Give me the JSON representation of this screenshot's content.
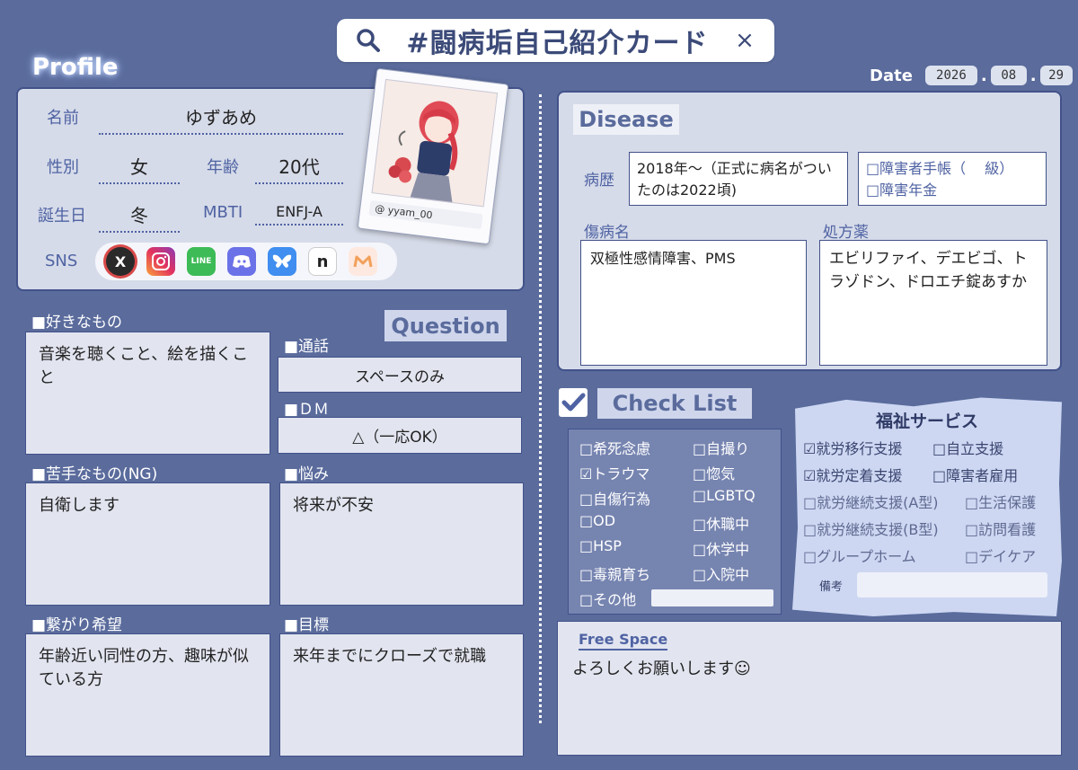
{
  "search": {
    "query": "#闘病垢自己紹介カード",
    "search_icon": "search-icon",
    "close_label": "×"
  },
  "profile": {
    "title": "Profile",
    "name_label": "名前",
    "name_value": "ゆずあめ",
    "gender_label": "性別",
    "gender_value": "女",
    "age_label": "年齢",
    "age_value": "20代",
    "birthday_label": "誕生日",
    "birthday_value": "冬",
    "mbti_label": "MBTI",
    "mbti_value": "ENFJ-A",
    "sns_label": "SNS",
    "photo_handle": "@ yyam_00",
    "sns_icons": [
      "x-icon",
      "instagram-icon",
      "line-icon",
      "discord-icon",
      "bluesky-icon",
      "note-icon",
      "misskey-icon"
    ]
  },
  "date": {
    "label": "Date",
    "year": "2026",
    "month": "08",
    "day": "29"
  },
  "question": {
    "badge": "Question",
    "likes_label": "■好きなもの",
    "likes_value": "音楽を聴くこと、絵を描くこと",
    "call_label": "■通話",
    "call_value": "スペースのみ",
    "dm_label": "■ＤＭ",
    "dm_value": "△（一応OK）",
    "dislikes_label": "■苦手なもの(NG)",
    "dislikes_value": "自衛します",
    "worry_label": "■悩み",
    "worry_value": "将来が不安",
    "connect_label": "■繋がり希望",
    "connect_value": "年齢近い同性の方、趣味が似ている方",
    "goal_label": "■目標",
    "goal_value": "来年までにクローズで就職"
  },
  "disease": {
    "badge": "Disease",
    "history_label": "病歴",
    "history_value": "2018年〜（正式に病名がついたのは2022頃)",
    "handbook_label": "□障害者手帳（　 級）",
    "pension_label": "□障害年金",
    "diagnosis_label": "傷病名",
    "diagnosis_value": "双極性感情障害、PMS",
    "medicine_label": "処方薬",
    "medicine_value": "エビリファイ、デエビゴ、トラゾドン、ドロエチ錠あすか"
  },
  "checklist": {
    "badge": "Check List",
    "items": [
      "□希死念慮",
      "□自撮り",
      "☑トラウマ",
      "□惚気",
      "□自傷行為",
      "□LGBTQ",
      "□OD",
      "□休職中",
      "□HSP",
      "□休学中",
      "□毒親育ち",
      "□入院中",
      "□その他"
    ]
  },
  "welfare": {
    "title": "福祉サービス",
    "items": [
      "☑就労移行支援",
      "□自立支援",
      "☑就労定着支援",
      "□障害者雇用",
      "□就労継続支援(A型)",
      "□生活保護",
      "□就労継続支援(B型)",
      "□訪問看護",
      "□グループホーム",
      "□デイケア"
    ],
    "note_label": "備考"
  },
  "free": {
    "title": "Free Space",
    "text": "よろしくお願いします☺"
  }
}
